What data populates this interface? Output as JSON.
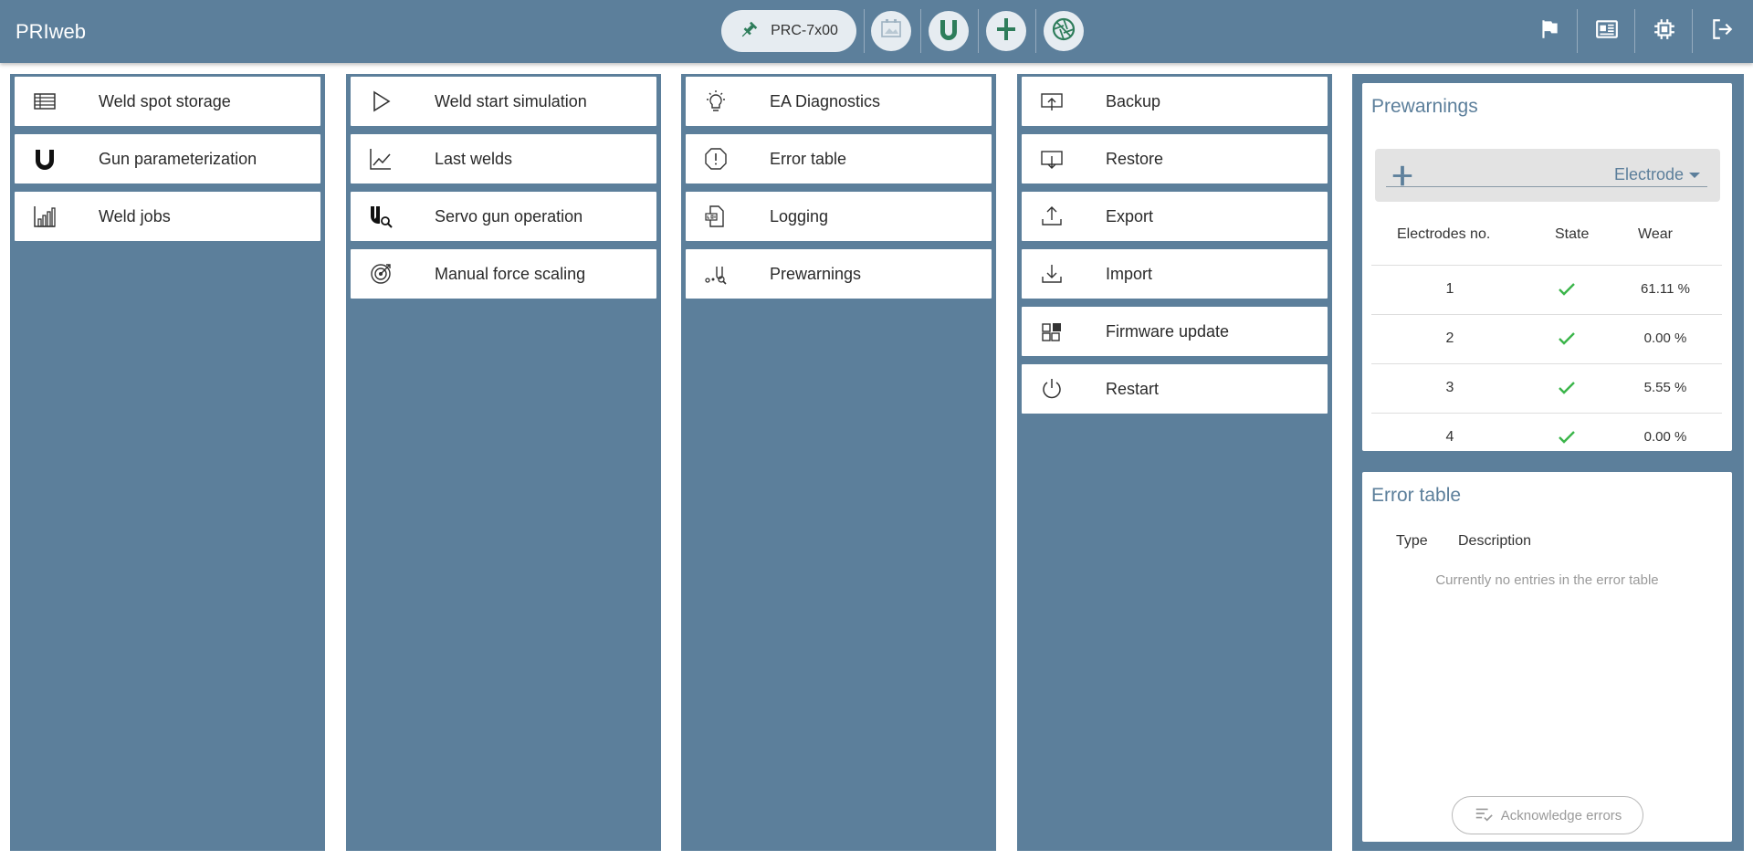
{
  "app": {
    "title": "PRIweb"
  },
  "topbar": {
    "device_label": "PRC-7x00",
    "icons": [
      "weld-spot-image-icon",
      "gun-icon",
      "electrode-icon",
      "aperture-icon"
    ],
    "right_icons": [
      "flag-icon",
      "id-card-icon",
      "chip-icon",
      "logout-icon"
    ]
  },
  "columns": [
    {
      "tiles": [
        {
          "label": "Weld spot storage",
          "icon": "table-icon"
        },
        {
          "label": "Gun parameterization",
          "icon": "gun-icon"
        },
        {
          "label": "Weld jobs",
          "icon": "bar-chart-icon"
        }
      ]
    },
    {
      "tiles": [
        {
          "label": "Weld start simulation",
          "icon": "play-icon"
        },
        {
          "label": "Last welds",
          "icon": "line-chart-icon"
        },
        {
          "label": "Servo gun operation",
          "icon": "gun-search-icon"
        },
        {
          "label": "Manual force scaling",
          "icon": "target-icon"
        }
      ]
    },
    {
      "tiles": [
        {
          "label": "EA Diagnostics",
          "icon": "lightbulb-icon"
        },
        {
          "label": "Error table",
          "icon": "alert-octagon-icon"
        },
        {
          "label": "Logging",
          "icon": "log-file-icon"
        },
        {
          "label": "Prewarnings",
          "icon": "prewarning-icon"
        }
      ]
    },
    {
      "tiles": [
        {
          "label": "Backup",
          "icon": "backup-icon"
        },
        {
          "label": "Restore",
          "icon": "restore-icon"
        },
        {
          "label": "Export",
          "icon": "upload-icon"
        },
        {
          "label": "Import",
          "icon": "download-icon"
        },
        {
          "label": "Firmware update",
          "icon": "firmware-icon"
        },
        {
          "label": "Restart",
          "icon": "power-icon"
        }
      ]
    }
  ],
  "prewarnings": {
    "title": "Prewarnings",
    "select_value": "Electrode",
    "headers": {
      "electrode_no": "Electrodes no.",
      "state": "State",
      "wear": "Wear"
    },
    "rows": [
      {
        "no": "1",
        "wear": "61.11 %"
      },
      {
        "no": "2",
        "wear": "0.00 %"
      },
      {
        "no": "3",
        "wear": "5.55 %"
      },
      {
        "no": "4",
        "wear": "0.00 %"
      }
    ]
  },
  "error_table": {
    "title": "Error table",
    "headers": {
      "type": "Type",
      "description": "Description"
    },
    "empty_message": "Currently no entries in the error table",
    "acknowledge_label": "Acknowledge errors"
  },
  "colors": {
    "primary": "#5c7f9b",
    "accent_green": "#2e7d5b",
    "check_green": "#3bb54a"
  }
}
